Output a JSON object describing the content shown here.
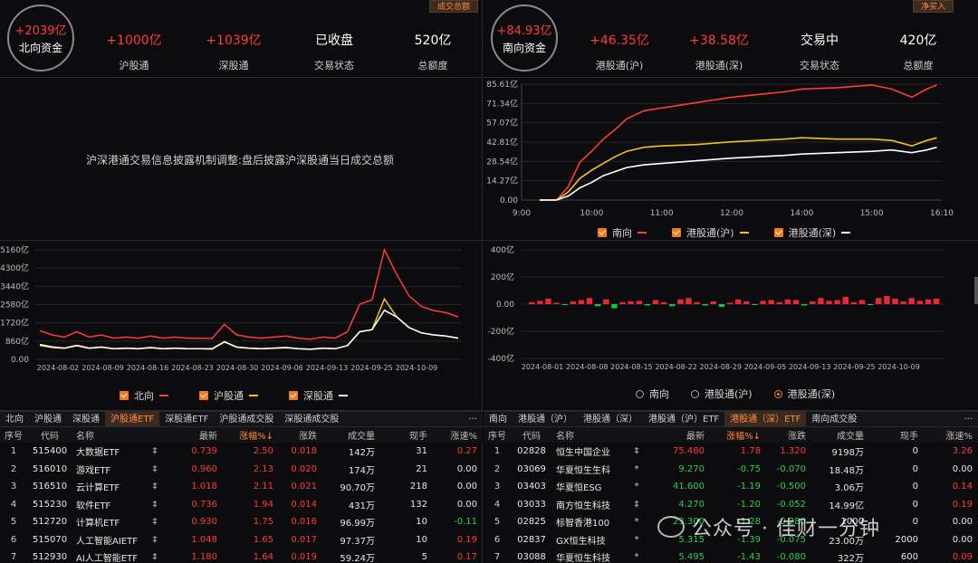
{
  "north": {
    "circle_value": "+2039亿",
    "circle_label": "北向资金",
    "corner_button": "成交总额",
    "stats": [
      {
        "value": "+1000亿",
        "label": "沪股通",
        "color": "red"
      },
      {
        "value": "+1039亿",
        "label": "深股通",
        "color": "red"
      },
      {
        "value": "已收盘",
        "label": "交易状态",
        "color": "white"
      },
      {
        "value": "520亿",
        "label": "总额度",
        "color": "white"
      }
    ],
    "notice": "沪深港通交易信息披露机制调整:盘后披露沪深股通当日成交总额"
  },
  "south": {
    "circle_value": "+84.93亿",
    "circle_label": "南向资金",
    "corner_button": "净买入",
    "stats": [
      {
        "value": "+46.35亿",
        "label": "港股通(沪)",
        "color": "red"
      },
      {
        "value": "+38.58亿",
        "label": "港股通(深)",
        "color": "red"
      },
      {
        "value": "交易中",
        "label": "交易状态",
        "color": "white"
      },
      {
        "value": "420亿",
        "label": "总额度",
        "color": "white"
      }
    ]
  },
  "intraday_chart": {
    "y_ticks": [
      "85.61亿",
      "71.34亿",
      "57.07亿",
      "42.81亿",
      "28.54亿",
      "14.27亿",
      "0.00"
    ],
    "x_ticks": [
      "9:00",
      "10:00",
      "11:00",
      "12:00",
      "14:00",
      "15:00",
      "16:10"
    ],
    "legend": [
      {
        "label": "南向",
        "color": "#ff3b3b"
      },
      {
        "label": "港股通(沪)",
        "color": "#f2c21f"
      },
      {
        "label": "港股通(深)",
        "color": "#ffffff"
      }
    ]
  },
  "north_daily_chart": {
    "y_ticks": [
      "5160亿",
      "4300亿",
      "3440亿",
      "2580亿",
      "1720亿",
      "860亿",
      "0.00"
    ],
    "x_ticks": [
      "2024-08-02",
      "2024-08-09",
      "2024-08-16",
      "2024-08-23",
      "2024-08-30",
      "2024-09-06",
      "2024-09-13",
      "2024-09-25",
      "2024-10-09"
    ],
    "legend": [
      {
        "label": "北向",
        "color": "#ff3b3b"
      },
      {
        "label": "沪股通",
        "color": "#f2c21f"
      },
      {
        "label": "深股通",
        "color": "#ffffff"
      }
    ]
  },
  "south_daily_chart": {
    "y_ticks": [
      "400亿",
      "200亿",
      "0.00",
      "-200亿",
      "-400亿"
    ],
    "x_ticks": [
      "2024-08-01",
      "2024-08-08",
      "2024-08-15",
      "2024-08-22",
      "2024-08-29",
      "2024-09-05",
      "2024-09-13",
      "2024-09-25",
      "2024-10-09"
    ],
    "legend": [
      "南向",
      "港股通(沪)",
      "港股通(深)"
    ],
    "selected": 2
  },
  "chart_data": [
    {
      "type": "line",
      "ylim": [
        0,
        85.61
      ],
      "x_range": [
        "9:00",
        "16:10"
      ],
      "series": [
        {
          "name": "南向",
          "x": [
            "9:30",
            "9:40",
            "9:50",
            "10:00",
            "10:10",
            "10:20",
            "10:30",
            "10:45",
            "11:00",
            "11:30",
            "12:00",
            "13:30",
            "14:00",
            "14:30",
            "15:00",
            "15:20",
            "15:40",
            "15:55",
            "16:05"
          ],
          "values": [
            0,
            10,
            28,
            36,
            45,
            52,
            60,
            66,
            68,
            72,
            76,
            80,
            82,
            83,
            85,
            82,
            76,
            82,
            85
          ]
        },
        {
          "name": "港股通(沪)",
          "x": [
            "9:30",
            "9:40",
            "9:50",
            "10:00",
            "10:10",
            "10:20",
            "10:30",
            "10:45",
            "11:00",
            "11:30",
            "12:00",
            "13:30",
            "14:00",
            "14:30",
            "15:00",
            "15:20",
            "15:40",
            "15:55",
            "16:05"
          ],
          "values": [
            0,
            6,
            16,
            22,
            27,
            32,
            36,
            39,
            40,
            41,
            43,
            45,
            46,
            45,
            45,
            44,
            40,
            44,
            46
          ]
        },
        {
          "name": "港股通(深)",
          "x": [
            "9:30",
            "9:40",
            "9:50",
            "10:00",
            "10:10",
            "10:20",
            "10:30",
            "10:45",
            "11:00",
            "11:30",
            "12:00",
            "13:30",
            "14:00",
            "14:30",
            "15:00",
            "15:20",
            "15:40",
            "15:55",
            "16:05"
          ],
          "values": [
            0,
            3,
            9,
            13,
            18,
            21,
            24,
            26,
            27,
            29,
            31,
            33,
            34,
            35,
            36,
            37,
            35,
            37,
            39
          ]
        }
      ]
    },
    {
      "type": "line",
      "ylim": [
        0,
        5160
      ],
      "series": [
        {
          "name": "北向",
          "values": [
            1350,
            1150,
            1050,
            1300,
            1050,
            1150,
            1000,
            1050,
            1000,
            1100,
            1000,
            1050,
            1000,
            1000,
            980,
            1650,
            1150,
            1050,
            1000,
            1050,
            1100,
            1000,
            950,
            1050,
            1000,
            1300,
            2600,
            2800,
            5160,
            4000,
            3000,
            2500,
            2300,
            2200,
            2000
          ]
        },
        {
          "name": "沪股通",
          "values": [
            650,
            560,
            520,
            640,
            520,
            570,
            500,
            520,
            500,
            540,
            500,
            520,
            500,
            500,
            480,
            820,
            570,
            520,
            500,
            520,
            540,
            500,
            470,
            520,
            500,
            650,
            1300,
            1400,
            2850,
            2000,
            1500,
            1250,
            1150,
            1100,
            1000
          ]
        },
        {
          "name": "深股通",
          "values": [
            700,
            590,
            530,
            660,
            530,
            580,
            500,
            530,
            500,
            560,
            500,
            530,
            500,
            500,
            500,
            830,
            580,
            530,
            500,
            530,
            560,
            500,
            480,
            530,
            500,
            650,
            1300,
            1400,
            2310,
            2000,
            1500,
            1250,
            1150,
            1100,
            1000
          ]
        }
      ]
    },
    {
      "type": "bar",
      "ylim": [
        -400,
        400
      ],
      "series": [
        {
          "name": "港股通(深)",
          "values": [
            15,
            25,
            40,
            10,
            -5,
            20,
            30,
            45,
            -15,
            35,
            -30,
            15,
            20,
            25,
            -10,
            30,
            15,
            -15,
            35,
            45,
            15,
            -10,
            20,
            -20,
            10,
            35,
            20,
            -5,
            25,
            30,
            15,
            35,
            30,
            -10,
            20,
            45,
            25,
            30,
            55,
            15,
            30,
            -5,
            45,
            60,
            40,
            20,
            45,
            25,
            35,
            40
          ]
        }
      ]
    }
  ],
  "north_table": {
    "tabs": [
      "北向",
      "沪股通",
      "深股通",
      "沪股通ETF",
      "深股通ETF",
      "沪股通成交股",
      "深股通成交股"
    ],
    "active_tab": 3,
    "more": "···",
    "columns": [
      "序号",
      "代码",
      "名称",
      "",
      "最新",
      "涨幅%↓",
      "涨跌",
      "成交量",
      "现手",
      "涨速%"
    ],
    "rows": [
      {
        "idx": "1",
        "code": "515400",
        "name": "大数据ETF",
        "flag": "‡",
        "last": "0.739",
        "chg_pct": "2.50",
        "chg": "0.018",
        "vol": "142万",
        "hand": "31",
        "speed": "0.27",
        "speed_color": "red"
      },
      {
        "idx": "2",
        "code": "516010",
        "name": "游戏ETF",
        "flag": "‡",
        "last": "0.960",
        "chg_pct": "2.13",
        "chg": "0.020",
        "vol": "174万",
        "hand": "21",
        "speed": "0.00",
        "speed_color": "white"
      },
      {
        "idx": "3",
        "code": "516510",
        "name": "云计算ETF",
        "flag": "‡",
        "last": "1.018",
        "chg_pct": "2.11",
        "chg": "0.021",
        "vol": "90.70万",
        "hand": "218",
        "speed": "0.00",
        "speed_color": "white"
      },
      {
        "idx": "4",
        "code": "515230",
        "name": "软件ETF",
        "flag": "‡",
        "last": "0.736",
        "chg_pct": "1.94",
        "chg": "0.014",
        "vol": "431万",
        "hand": "132",
        "speed": "0.00",
        "speed_color": "white"
      },
      {
        "idx": "5",
        "code": "512720",
        "name": "计算机ETF",
        "flag": "‡",
        "last": "0.930",
        "chg_pct": "1.75",
        "chg": "0.016",
        "vol": "96.99万",
        "hand": "10",
        "speed": "-0.11",
        "speed_color": "green"
      },
      {
        "idx": "6",
        "code": "515070",
        "name": "人工智能AIETF",
        "flag": "‡",
        "last": "1.048",
        "chg_pct": "1.65",
        "chg": "0.017",
        "vol": "97.37万",
        "hand": "10",
        "speed": "0.19",
        "speed_color": "red"
      },
      {
        "idx": "7",
        "code": "512930",
        "name": "AI人工智能ETF",
        "flag": "‡",
        "last": "1.180",
        "chg_pct": "1.64",
        "chg": "0.019",
        "vol": "59.24万",
        "hand": "5",
        "speed": "0.17",
        "speed_color": "red"
      }
    ]
  },
  "south_table": {
    "tabs": [
      "南向",
      "港股通（沪）",
      "港股通（深）",
      "港股通（沪）ETF",
      "港股通（深）ETF",
      "南向成交股"
    ],
    "active_tab": 4,
    "more": "···",
    "columns": [
      "序号",
      "代码",
      "名称",
      "",
      "最新",
      "涨幅%↓",
      "涨跌",
      "成交量",
      "现手",
      "涨速%"
    ],
    "rows": [
      {
        "idx": "1",
        "code": "02828",
        "name": "恒生中国企业",
        "flag": "‡",
        "last": "75.480",
        "last_color": "red",
        "chg_pct": "1.78",
        "pct_color": "red",
        "chg": "1.320",
        "chg_color": "red",
        "vol": "9198万",
        "hand": "0",
        "speed": "3.26",
        "speed_color": "red"
      },
      {
        "idx": "2",
        "code": "03069",
        "name": "华夏恒生生科",
        "flag": "*",
        "last": "9.270",
        "last_color": "green",
        "chg_pct": "-0.75",
        "pct_color": "green",
        "chg": "-0.070",
        "chg_color": "green",
        "vol": "18.48万",
        "hand": "0",
        "speed": "0.00",
        "speed_color": "white"
      },
      {
        "idx": "3",
        "code": "03403",
        "name": "华夏恒ESG",
        "flag": "*",
        "last": "41.600",
        "last_color": "green",
        "chg_pct": "-1.19",
        "pct_color": "green",
        "chg": "-0.500",
        "chg_color": "green",
        "vol": "3.06万",
        "hand": "0",
        "speed": "0.14",
        "speed_color": "red"
      },
      {
        "idx": "4",
        "code": "03033",
        "name": "南方恒生科技",
        "flag": "‡",
        "last": "4.270",
        "last_color": "green",
        "chg_pct": "-1.20",
        "pct_color": "green",
        "chg": "-0.052",
        "chg_color": "green",
        "vol": "14.99亿",
        "hand": "0",
        "speed": "0.19",
        "speed_color": "red"
      },
      {
        "idx": "5",
        "code": "02825",
        "name": "标智香港100",
        "flag": "*",
        "last": "23.300",
        "last_color": "green",
        "chg_pct": "-1.28",
        "pct_color": "green",
        "chg": "-0.280",
        "chg_color": "green",
        "vol": "1000",
        "hand": "0",
        "speed": "0.00",
        "speed_color": "white"
      },
      {
        "idx": "6",
        "code": "02837",
        "name": "GX恒生科技",
        "flag": "*",
        "last": "5.315",
        "last_color": "green",
        "chg_pct": "-1.39",
        "pct_color": "green",
        "chg": "-0.075",
        "chg_color": "green",
        "vol": "23.00万",
        "hand": "2000",
        "speed": "0.00",
        "speed_color": "white"
      },
      {
        "idx": "7",
        "code": "03088",
        "name": "华夏恒生科技",
        "flag": "*",
        "last": "5.495",
        "last_color": "green",
        "chg_pct": "-1.43",
        "pct_color": "green",
        "chg": "-0.080",
        "chg_color": "green",
        "vol": "322万",
        "hand": "600",
        "speed": "0.09",
        "speed_color": "red"
      }
    ]
  },
  "watermark": "公众号 · 佳财一分钟"
}
